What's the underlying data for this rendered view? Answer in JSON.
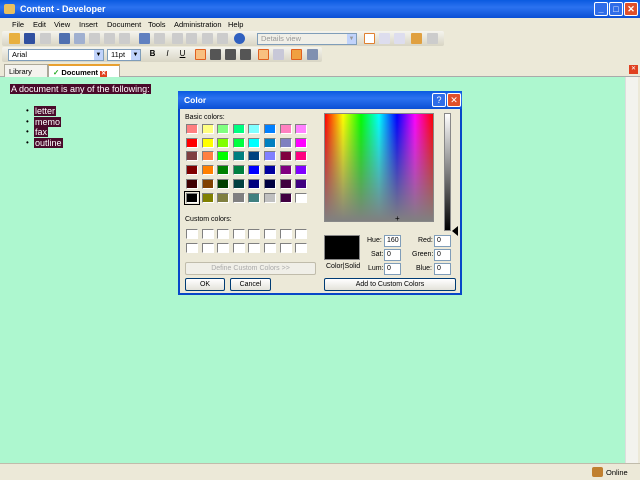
{
  "window": {
    "title": "Content - Developer",
    "minimize": "_",
    "maximize": "□",
    "close": "✕"
  },
  "menu": [
    "File",
    "Edit",
    "View",
    "Insert",
    "Document",
    "Tools",
    "Administration",
    "Help"
  ],
  "toolbar": {
    "view_select": "Details view",
    "font": "Arial",
    "size": "11pt",
    "bold": "B",
    "italic": "I",
    "underline": "U"
  },
  "tabs": [
    {
      "label": "Library"
    },
    {
      "label": "Document"
    }
  ],
  "document": {
    "intro": "A document is any of the following:",
    "items": [
      "letter",
      "memo",
      "fax",
      "outline"
    ]
  },
  "status": {
    "text": "Online"
  },
  "dialog": {
    "title": "Color",
    "help": "?",
    "close": "✕",
    "basic_label": "Basic colors:",
    "custom_label": "Custom colors:",
    "basic_colors": [
      "#FF8080",
      "#FFFF80",
      "#80FF80",
      "#00FF80",
      "#80FFFF",
      "#0080FF",
      "#FF80C0",
      "#FF80FF",
      "#FF0000",
      "#FFFF00",
      "#80FF00",
      "#00FF40",
      "#00FFFF",
      "#0080C0",
      "#8080C0",
      "#FF00FF",
      "#804040",
      "#FF8040",
      "#00FF00",
      "#008080",
      "#004080",
      "#8080FF",
      "#800040",
      "#FF0080",
      "#800000",
      "#FF8000",
      "#008000",
      "#008040",
      "#0000FF",
      "#0000A0",
      "#800080",
      "#8000FF",
      "#400000",
      "#804000",
      "#004000",
      "#004040",
      "#000080",
      "#000040",
      "#400040",
      "#400080",
      "#000000",
      "#808000",
      "#808040",
      "#808080",
      "#408080",
      "#C0C0C0",
      "#400040",
      "#FFFFFF"
    ],
    "selected_color": "#000000",
    "color_solid_label": "Color|Solid",
    "fields": {
      "hue_label": "Hue:",
      "hue": "160",
      "sat_label": "Sat:",
      "sat": "0",
      "lum_label": "Lum:",
      "lum": "0",
      "red_label": "Red:",
      "red": "0",
      "green_label": "Green:",
      "green": "0",
      "blue_label": "Blue:",
      "blue": "0"
    },
    "define_button": "Define Custom Colors >>",
    "ok_button": "OK",
    "cancel_button": "Cancel",
    "add_button": "Add to Custom Colors"
  }
}
